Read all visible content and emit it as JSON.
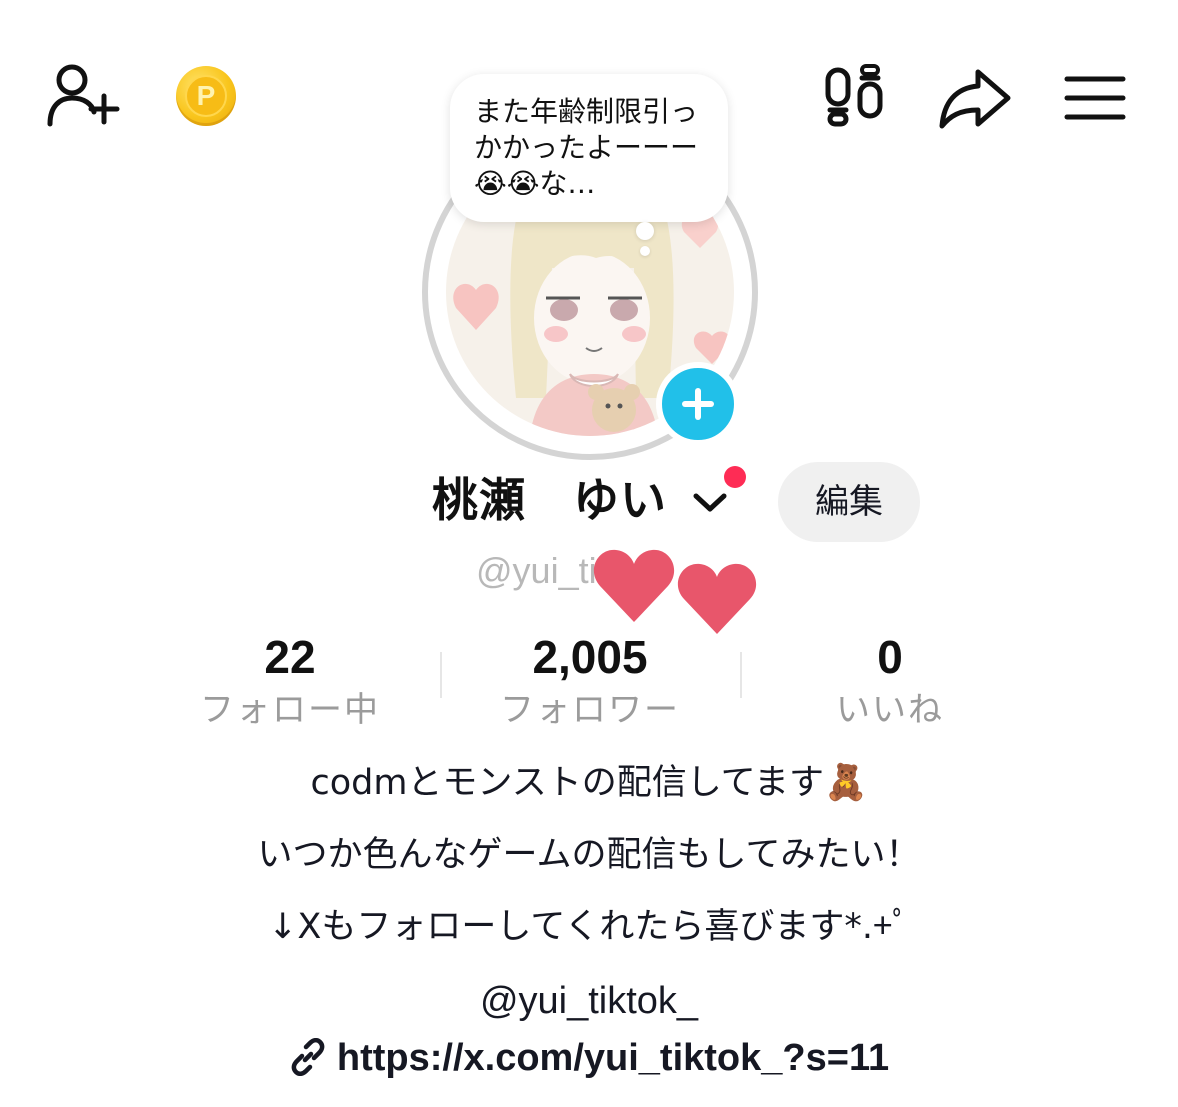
{
  "header": {
    "add_friend_icon": "person-plus-icon",
    "coin_icon": "p-coin-icon",
    "coin_letter": "P",
    "footprints_icon": "footprints-icon",
    "share_icon": "share-arrow-icon",
    "menu_icon": "hamburger-menu-icon"
  },
  "status_bubble": {
    "text": "また年齢制限引っかかったよーーー😭😭な…"
  },
  "profile": {
    "display_name": "桃瀬　ゆい",
    "username": "@yui_tiktok",
    "edit_label": "編集",
    "avatar_badge_icon": "plus-icon",
    "notification_dot_color": "#fe2c55",
    "accent_color": "#21c0e9",
    "stickers": [
      "heart-sticker",
      "heart-sticker"
    ]
  },
  "stats": [
    {
      "value": "22",
      "label": "フォロー中"
    },
    {
      "value": "2,005",
      "label": "フォロワー"
    },
    {
      "value": "0",
      "label": "いいね"
    }
  ],
  "bio": {
    "lines": [
      "codmとモンストの配信してます🧸",
      "いつか色んなゲームの配信もしてみたい！",
      "↓Xもフォローしてくれたら喜びます*.+ﾟ",
      "@yui_tiktok_"
    ],
    "link_icon": "link-icon",
    "link": "https://x.com/yui_tiktok_?s=11"
  }
}
